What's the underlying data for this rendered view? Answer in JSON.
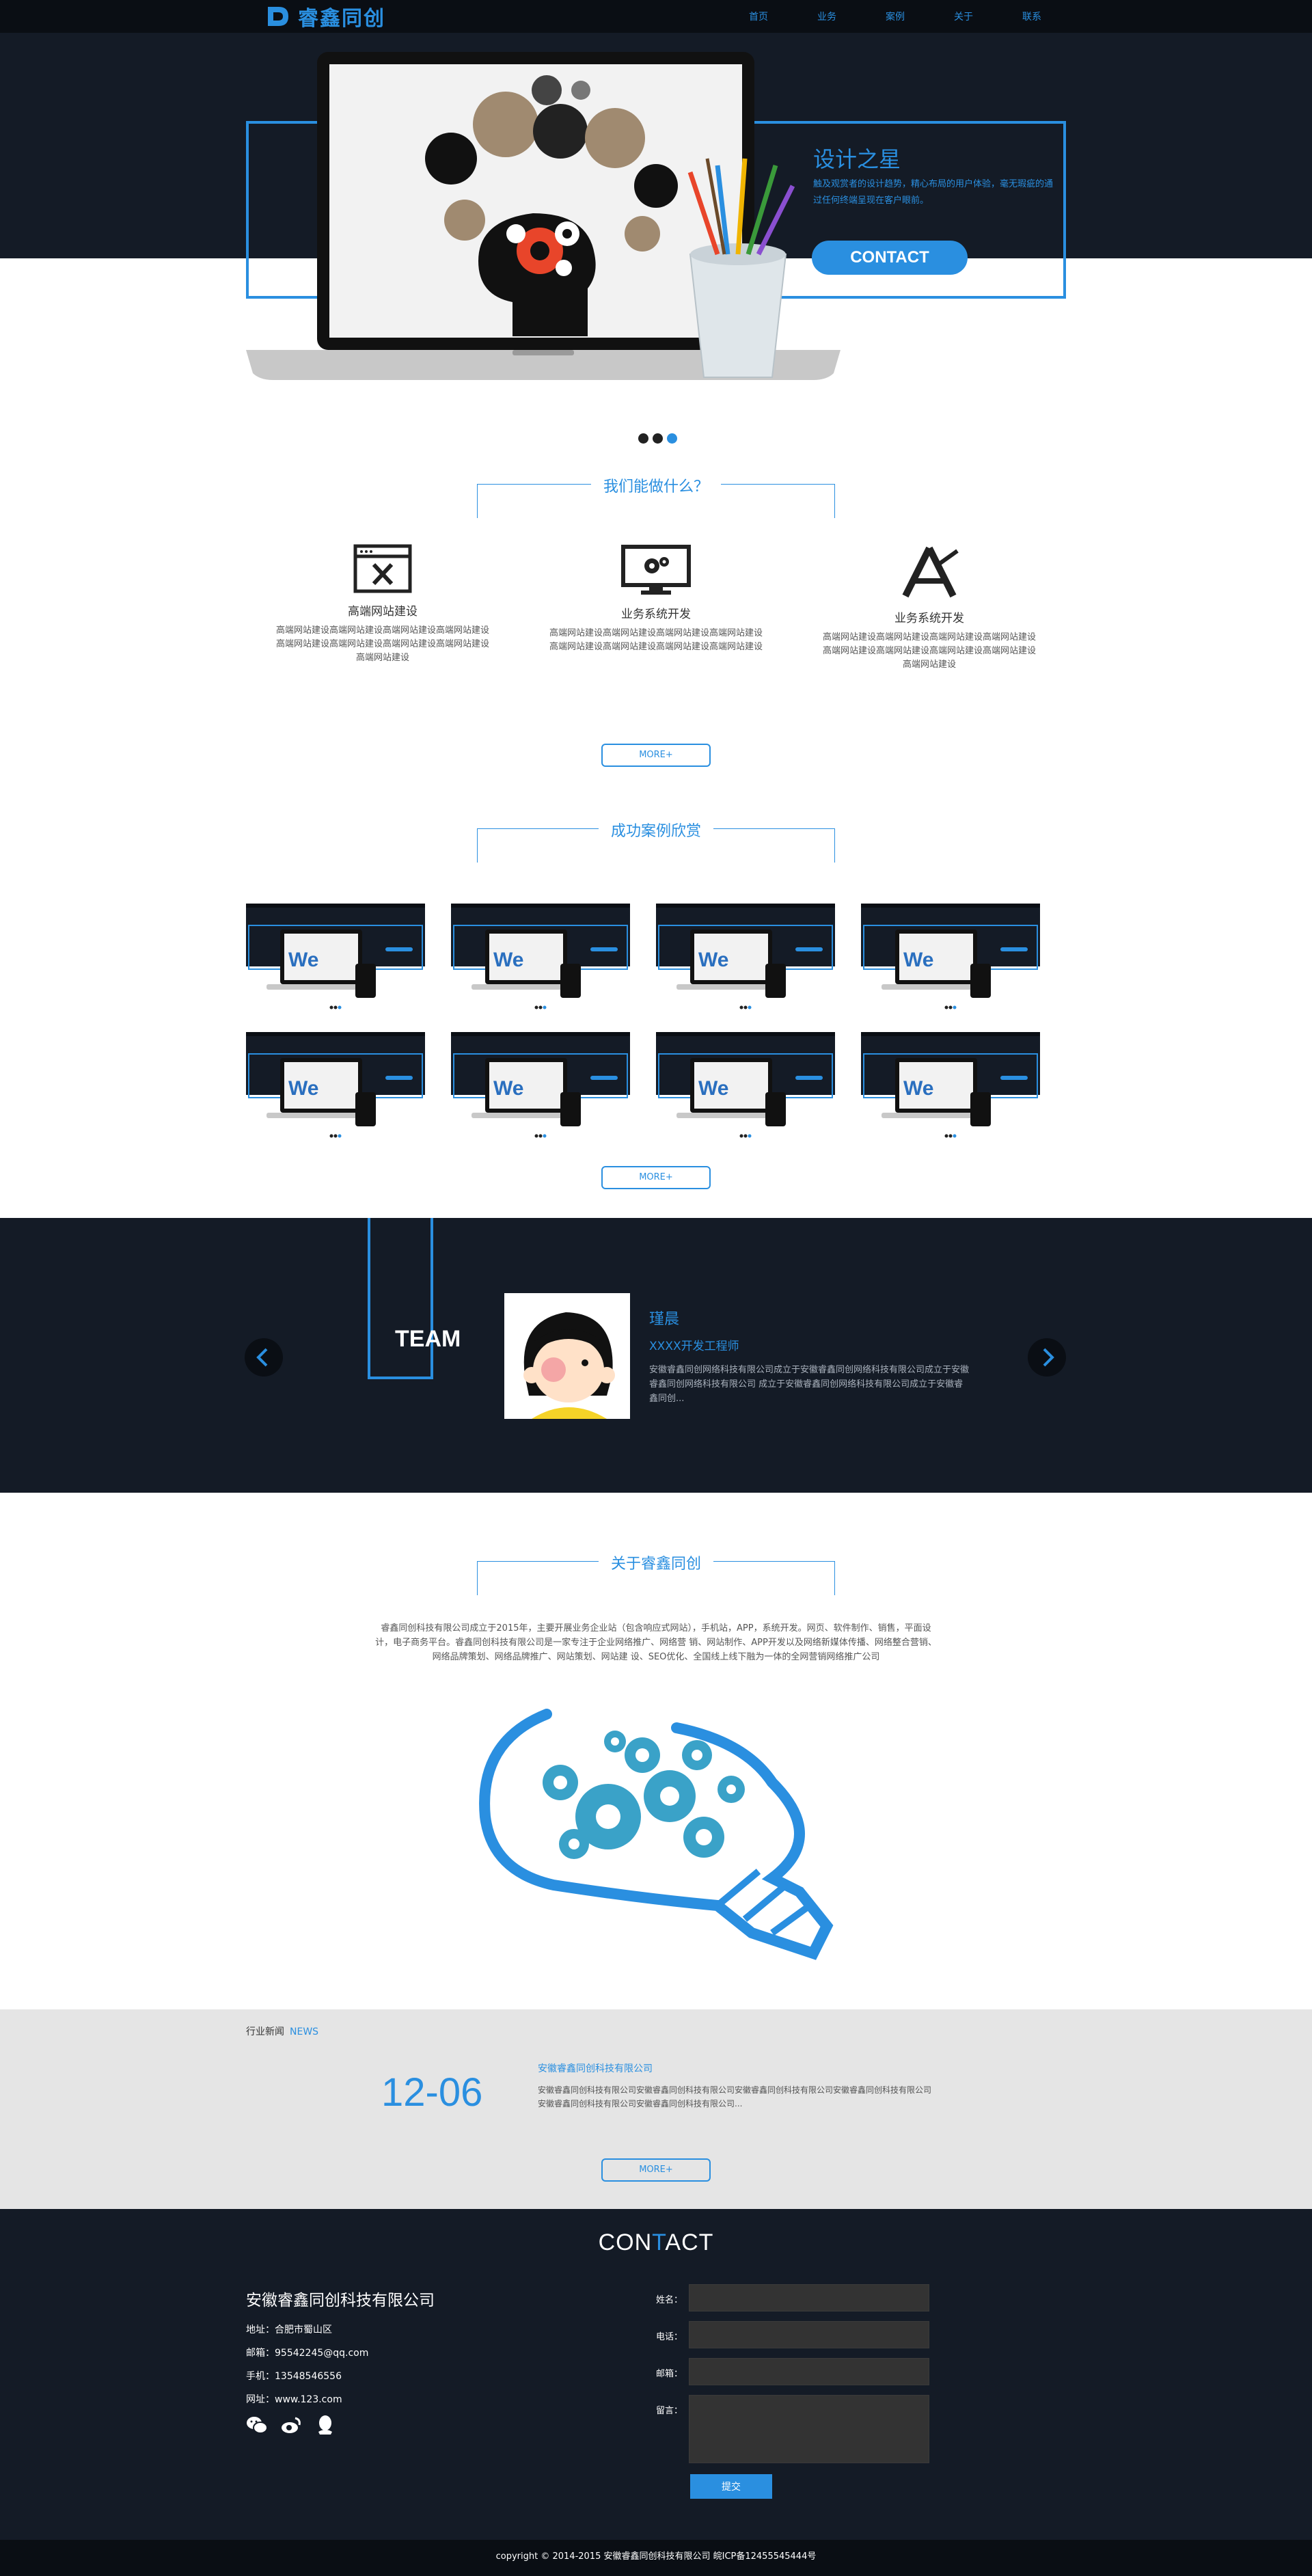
{
  "header": {
    "logo_text": "睿鑫同创",
    "nav": [
      "首页",
      "业务",
      "案例",
      "关于",
      "联系"
    ]
  },
  "hero": {
    "title": "设计之星",
    "desc": "触及观赏者的设计趋势，精心布局的用户体验，毫无瑕疵的通过任何终端呈现在客户眼前。",
    "button": "CONTACT",
    "slides": 3,
    "active_slide": 3
  },
  "services": {
    "heading": "我们能做什么？",
    "items": [
      {
        "title": "高端网站建设",
        "icon": "browser-tools-icon",
        "desc": "高端网站建设高端网站建设高端网站建设高端网站建设高端网站建设高端网站建设高端网站建设高端网站建设高端网站建设"
      },
      {
        "title": "业务系统开发",
        "icon": "monitor-gears-icon",
        "desc": "高端网站建设高端网站建设高端网站建设高端网站建设高端网站建设高端网站建设高端网站建设高端网站建设"
      },
      {
        "title": "业务系统开发",
        "icon": "app-store-icon",
        "desc": "高端网站建设高端网站建设高端网站建设高端网站建设高端网站建设高端网站建设高端网站建设高端网站建设高端网站建设"
      }
    ],
    "more": "MORE+"
  },
  "cases": {
    "heading": "成功案例欣赏",
    "count": 8,
    "more": "MORE+"
  },
  "team": {
    "label": "TEAM",
    "name": "瑾晨",
    "role": "XXXX开发工程师",
    "desc": "安徽睿鑫同创网络科技有限公司成立于安徽睿鑫同创网络科技有限公司成立于安徽睿鑫同创网络科技有限公司 成立于安徽睿鑫同创网络科技有限公司成立于安徽睿鑫同创..."
  },
  "about": {
    "heading": "关于睿鑫同创",
    "text": "睿鑫同创科技有限公司成立于2015年，主要开展业务企业站（包含响应式网站），手机站，APP，系统开发。网页、软件制作、销售，平面设计，电子商务平台。睿鑫同创科技有限公司是一家专注于企业网络推广、网络营 销、网站制作、APP开发以及网络新媒体传播、网络整合营销、网络品牌策划、网络品牌推广、网站策划、网站建 设、SEO优化、全国线上线下融为一体的全网营销网络推广公司"
  },
  "news": {
    "label": "行业新闻",
    "label_en": "NEWS",
    "date": "12-06",
    "title": "安徽睿鑫同创科技有限公司",
    "desc": "安徽睿鑫同创科技有限公司安徽睿鑫同创科技有限公司安徽睿鑫同创科技有限公司安徽睿鑫同创科技有限公司 安徽睿鑫同创科技有限公司安徽睿鑫同创科技有限公司...",
    "more": "MORE+"
  },
  "contact": {
    "title_pre": "CON",
    "title_hl": "T",
    "title_post": "ACT",
    "company": "安徽睿鑫同创科技有限公司",
    "address": "地址：合肥市蜀山区",
    "email": "邮箱：95542245@qq.com",
    "phone": "手机：13548546556",
    "website": "网址：www.123.com",
    "form": {
      "name": "姓名：",
      "tel": "电话：",
      "mail": "邮箱：",
      "message": "留言：",
      "submit": "提交"
    }
  },
  "footer": {
    "copyright": "copyright © 2014-2015 安徽睿鑫同创科技有限公司 皖ICP备12455545444号"
  },
  "colors": {
    "accent": "#2a8fe0",
    "dark": "#141b26",
    "darker": "#0a0e14",
    "news_bg": "#e5e5e5"
  }
}
